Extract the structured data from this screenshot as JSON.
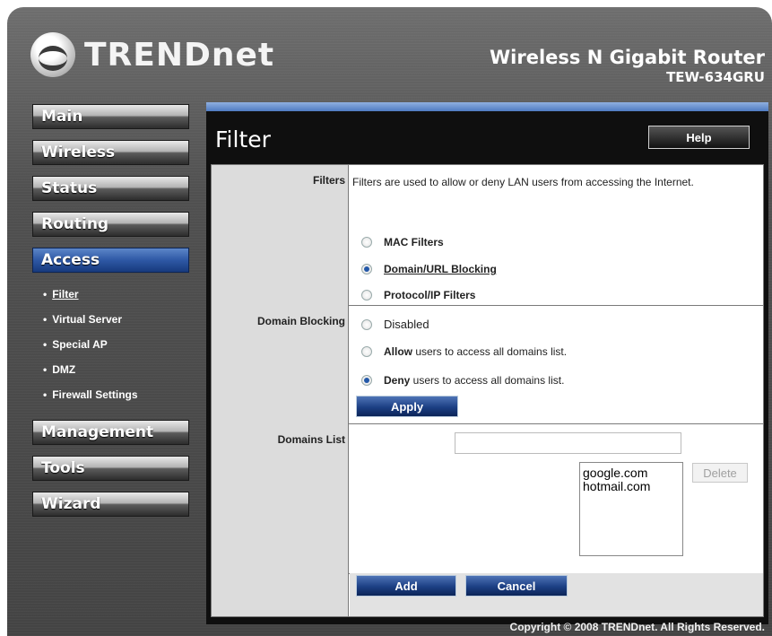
{
  "header": {
    "brand": "TRENDnet",
    "product_name": "Wireless N Gigabit Router",
    "model": "TEW-634GRU"
  },
  "nav": {
    "items": [
      {
        "label": "Main"
      },
      {
        "label": "Wireless"
      },
      {
        "label": "Status"
      },
      {
        "label": "Routing"
      },
      {
        "label": "Access"
      },
      {
        "label": "Management"
      },
      {
        "label": "Tools"
      },
      {
        "label": "Wizard"
      }
    ],
    "access_sub": [
      {
        "label": "Filter"
      },
      {
        "label": "Virtual Server"
      },
      {
        "label": "Special AP"
      },
      {
        "label": "DMZ"
      },
      {
        "label": "Firewall Settings"
      }
    ],
    "bullet": "•"
  },
  "page": {
    "title": "Filter",
    "help_label": "Help"
  },
  "filters": {
    "label": "Filters",
    "description": "Filters are used to allow or deny LAN users from accessing the Internet.",
    "options": [
      {
        "label": "MAC Filters",
        "selected": false
      },
      {
        "label": "Domain/URL Blocking",
        "selected": true
      },
      {
        "label": "Protocol/IP Filters",
        "selected": false
      }
    ]
  },
  "domain_blocking": {
    "label": "Domain Blocking",
    "disabled_label": "Disabled",
    "allow_bold": "Allow",
    "allow_rest": " users to access all domains list.",
    "deny_bold": "Deny",
    "deny_rest": " users to access all domains list.",
    "selected": "deny",
    "apply_label": "Apply"
  },
  "domains_list": {
    "label": "Domains List",
    "input_value": "",
    "entries": [
      "google.com",
      "hotmail.com"
    ],
    "delete_label": "Delete"
  },
  "actions": {
    "add_label": "Add",
    "cancel_label": "Cancel"
  },
  "footer": {
    "copyright": "Copyright © 2008 TRENDnet. All Rights Reserved."
  },
  "colors": {
    "accent": "#2e58a5",
    "panel": "#0f0f0f",
    "label_bg": "#dcdcdc"
  }
}
